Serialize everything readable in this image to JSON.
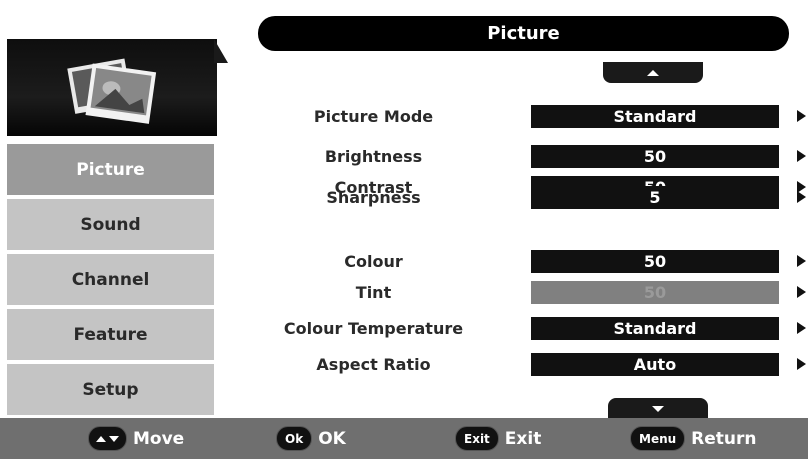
{
  "title": "Picture",
  "left_menu": [
    {
      "label": "Picture",
      "active": true
    },
    {
      "label": "Sound",
      "active": false
    },
    {
      "label": "Channel",
      "active": false
    },
    {
      "label": "Feature",
      "active": false
    },
    {
      "label": "Setup",
      "active": false
    }
  ],
  "settings": [
    {
      "label": "Picture Mode",
      "value": "Standard",
      "enabled": true
    },
    {
      "label": "Brightness",
      "value": "50",
      "enabled": true
    },
    {
      "label": "Contrast",
      "value": "50",
      "enabled": true
    },
    {
      "label": "Sharpness",
      "value": "5",
      "enabled": true
    },
    {
      "label": "Colour",
      "value": "50",
      "enabled": true
    },
    {
      "label": "Tint",
      "value": "50",
      "enabled": false
    },
    {
      "label": "Colour Temperature",
      "value": "Standard",
      "enabled": true
    },
    {
      "label": "Aspect Ratio",
      "value": "Auto",
      "enabled": true
    }
  ],
  "footer": {
    "move_label": "Move",
    "ok_key": "Ok",
    "ok_label": "OK",
    "exit_key": "Exit",
    "exit_label": "Exit",
    "menu_key": "Menu",
    "return_label": "Return"
  },
  "icons": {
    "header": "picture-photos-icon",
    "scroll_up": "scroll-up-icon",
    "scroll_down": "scroll-down-icon",
    "right_arrow": "chevron-right-icon"
  }
}
